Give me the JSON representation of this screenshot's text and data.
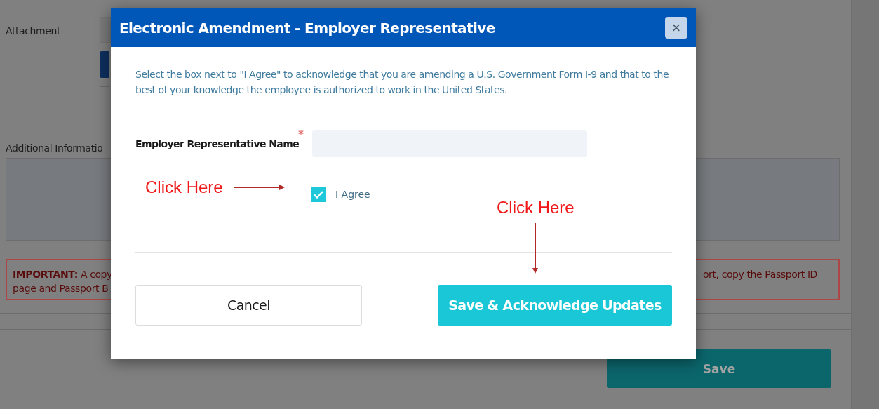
{
  "background": {
    "attachment_label": "Attachment",
    "additional_info_label": "Additional Informatio",
    "important_left": [
      "**IMPORTANT:** A copy",
      "page and Passport B"
    ],
    "important_right": [
      "ort, copy the Passport ID"
    ],
    "attachment_checkbox": {
      "checked": false
    },
    "save_button": "Save"
  },
  "dialog": {
    "title": "Electronic Amendment - Employer Representative",
    "close": "×",
    "instructions": "Select the box next to \"I Agree\" to acknowledge that you are amending a U.S. Government Form I-9 and that to the best of your knowledge the employee is authorized to work in the United States.",
    "name_field": {
      "label": "Employer Representative Name",
      "required_mark": "*"
    },
    "agree": {
      "label": "I Agree",
      "checked": true
    },
    "buttons": [
      {
        "label": "Cancel",
        "kind": "secondary"
      },
      {
        "label": "Save & Acknowledge Updates",
        "kind": "primary"
      }
    ]
  },
  "annotations": [
    {
      "text": "Click Here",
      "kind": "arrow-right"
    },
    {
      "text": "Click Here",
      "kind": "arrow-down"
    }
  ]
}
